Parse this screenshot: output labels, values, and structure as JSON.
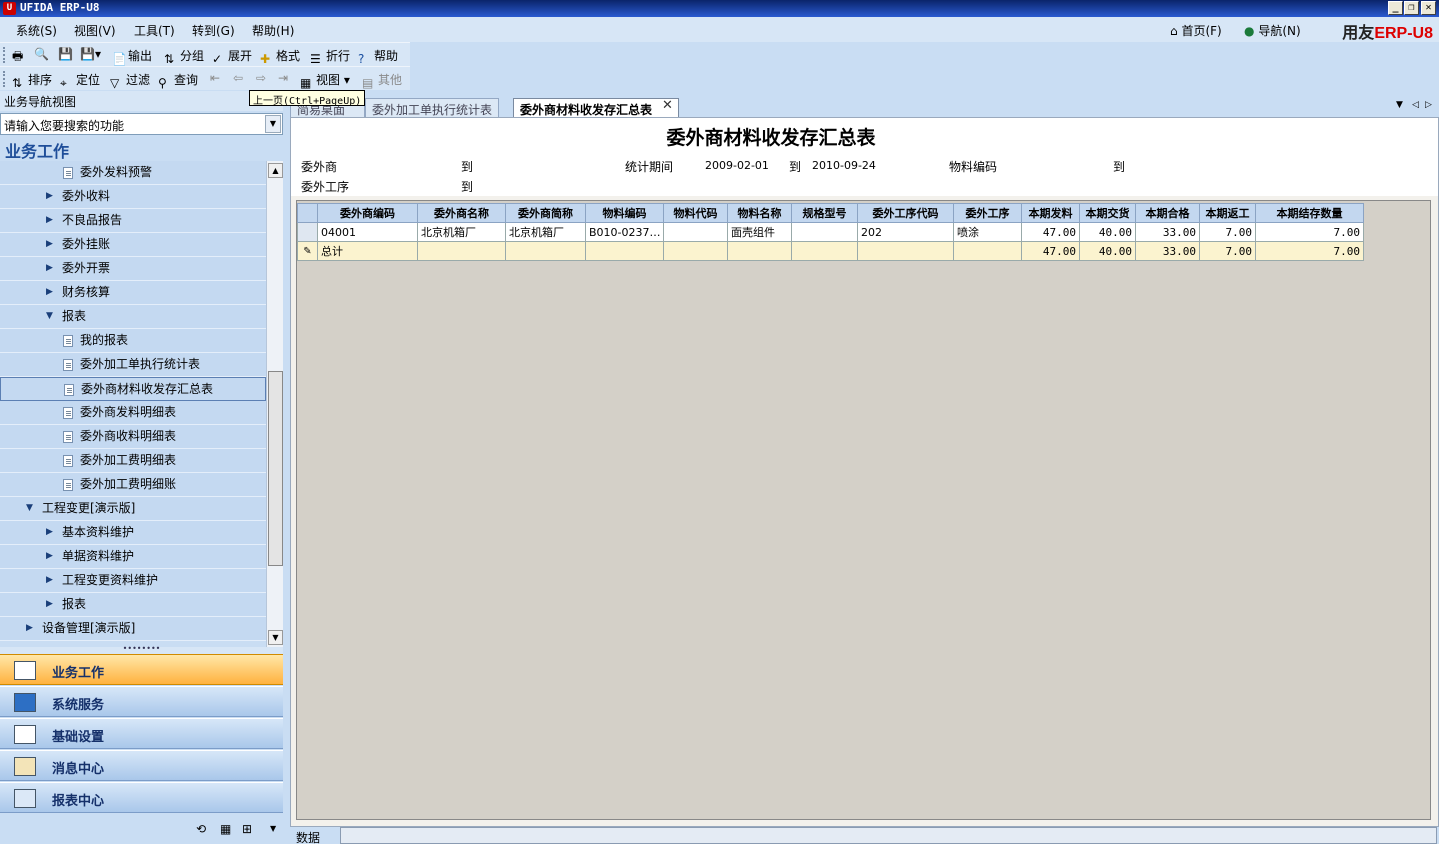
{
  "window": {
    "title": "UFIDA ERP-U8",
    "logo_letter": "U"
  },
  "menubar": {
    "items": [
      "系统(S)",
      "视图(V)",
      "工具(T)",
      "转到(G)",
      "帮助(H)"
    ],
    "home": "首页(F)",
    "nav": "导航(N)",
    "brand_a": "用友",
    "brand_b": "ERP-U8"
  },
  "toolbar1": {
    "output": "输出",
    "group": "分组",
    "expand": "展开",
    "format": "格式",
    "fold": "折行",
    "help": "帮助"
  },
  "toolbar2": {
    "sort": "排序",
    "locate": "定位",
    "filter": "过滤",
    "query": "查询",
    "view": "视图",
    "other": "其他"
  },
  "tooltip": "上一页(Ctrl+PageUp)",
  "nav": {
    "header": "业务导航视图",
    "search_placeholder": "请输入您要搜索的功能",
    "workspace_title": "业务工作",
    "tree": [
      {
        "label": "委外发料预警",
        "level": 3,
        "type": "doc"
      },
      {
        "label": "委外收料",
        "level": 2,
        "type": "collapsed"
      },
      {
        "label": "不良品报告",
        "level": 2,
        "type": "collapsed"
      },
      {
        "label": "委外挂账",
        "level": 2,
        "type": "collapsed"
      },
      {
        "label": "委外开票",
        "level": 2,
        "type": "collapsed"
      },
      {
        "label": "财务核算",
        "level": 2,
        "type": "collapsed"
      },
      {
        "label": "报表",
        "level": 2,
        "type": "expanded"
      },
      {
        "label": "我的报表",
        "level": 3,
        "type": "doc"
      },
      {
        "label": "委外加工单执行统计表",
        "level": 3,
        "type": "doc"
      },
      {
        "label": "委外商材料收发存汇总表",
        "level": 3,
        "type": "doc",
        "selected": true
      },
      {
        "label": "委外商发料明细表",
        "level": 3,
        "type": "doc"
      },
      {
        "label": "委外商收料明细表",
        "level": 3,
        "type": "doc"
      },
      {
        "label": "委外加工费明细表",
        "level": 3,
        "type": "doc"
      },
      {
        "label": "委外加工费明细账",
        "level": 3,
        "type": "doc"
      },
      {
        "label": "工程变更[演示版]",
        "level": 1,
        "type": "expanded"
      },
      {
        "label": "基本资料维护",
        "level": 2,
        "type": "collapsed"
      },
      {
        "label": "单据资料维护",
        "level": 2,
        "type": "collapsed"
      },
      {
        "label": "工程变更资料维护",
        "level": 2,
        "type": "collapsed"
      },
      {
        "label": "报表",
        "level": 2,
        "type": "collapsed"
      },
      {
        "label": "设备管理[演示版]",
        "level": 1,
        "type": "collapsed"
      }
    ],
    "panels": [
      "业务工作",
      "系统服务",
      "基础设置",
      "消息中心",
      "报表中心"
    ]
  },
  "tabs": [
    "简易桌面",
    "委外加工单执行统计表",
    "委外商材料收发存汇总表"
  ],
  "report": {
    "title": "委外商材料收发存汇总表",
    "cond": {
      "vendor": "委外商",
      "to1": "到",
      "period": "统计期间",
      "start": "2009-02-01",
      "to2": "到",
      "end": "2010-09-24",
      "mat_code": "物料编码",
      "to3": "到",
      "process": "委外工序",
      "to4": "到"
    },
    "columns": [
      "委外商编码",
      "委外商名称",
      "委外商简称",
      "物料编码",
      "物料代码",
      "物料名称",
      "规格型号",
      "委外工序代码",
      "委外工序",
      "本期发料",
      "本期交货",
      "本期合格",
      "本期返工",
      "本期结存数量"
    ],
    "rows": [
      [
        "04001",
        "北京机箱厂",
        "北京机箱厂",
        "B010-0237…",
        "",
        "面壳组件",
        "",
        "202",
        "喷涂",
        "47.00",
        "40.00",
        "33.00",
        "7.00",
        "7.00"
      ]
    ],
    "total": [
      "总计",
      "",
      "",
      "",
      "",
      "",
      "",
      "",
      "",
      "47.00",
      "40.00",
      "33.00",
      "7.00",
      "7.00"
    ]
  },
  "status": {
    "label": "数据"
  }
}
